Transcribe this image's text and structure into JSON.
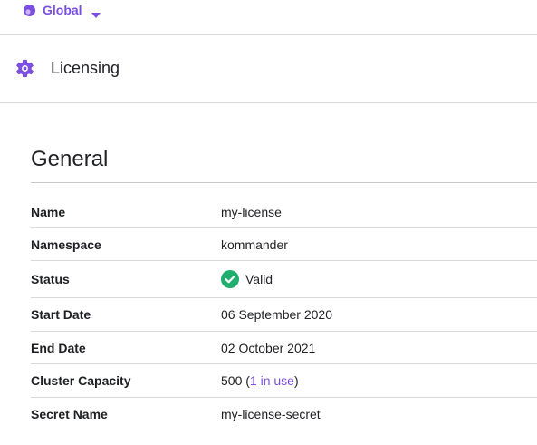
{
  "scope": {
    "label": "Global"
  },
  "page": {
    "title": "Licensing"
  },
  "section": {
    "title": "General"
  },
  "details": {
    "name": {
      "label": "Name",
      "value": "my-license"
    },
    "namespace": {
      "label": "Namespace",
      "value": "kommander"
    },
    "status": {
      "label": "Status",
      "value": "Valid"
    },
    "start_date": {
      "label": "Start Date",
      "value": "06 September 2020"
    },
    "end_date": {
      "label": "End Date",
      "value": "02 October 2021"
    },
    "cluster_capacity": {
      "label": "Cluster Capacity",
      "value": "500",
      "open": "(",
      "in_use": "1 in use",
      "close": ")"
    },
    "secret_name": {
      "label": "Secret Name",
      "value": "my-license-secret"
    }
  },
  "icons": {
    "scope": "globe-dot-icon",
    "scope_caret": "caret-down-icon",
    "header": "gear-icon",
    "status": "check-circle-icon"
  },
  "colors": {
    "accent": "#7B4FE0",
    "valid": "#1FAE6E",
    "text": "#1f2024",
    "divider": "#d9d9dc"
  }
}
